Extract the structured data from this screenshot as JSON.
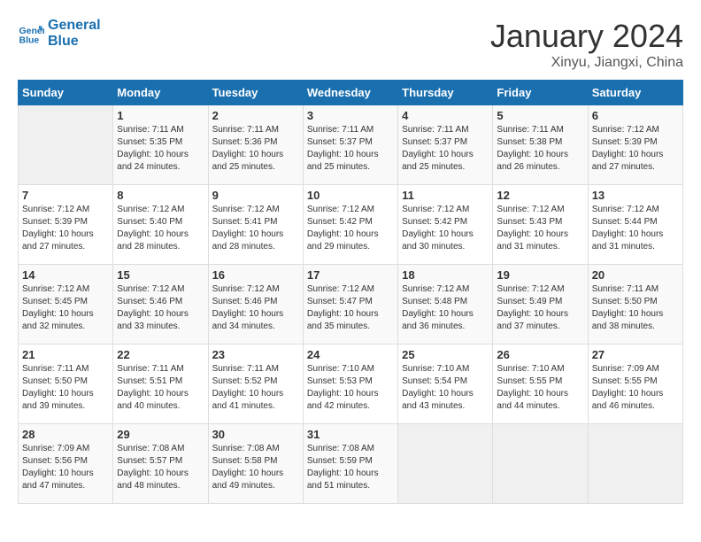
{
  "header": {
    "logo_line1": "General",
    "logo_line2": "Blue",
    "month": "January 2024",
    "location": "Xinyu, Jiangxi, China"
  },
  "weekdays": [
    "Sunday",
    "Monday",
    "Tuesday",
    "Wednesday",
    "Thursday",
    "Friday",
    "Saturday"
  ],
  "weeks": [
    [
      {
        "day": "",
        "info": ""
      },
      {
        "day": "1",
        "info": "Sunrise: 7:11 AM\nSunset: 5:35 PM\nDaylight: 10 hours\nand 24 minutes."
      },
      {
        "day": "2",
        "info": "Sunrise: 7:11 AM\nSunset: 5:36 PM\nDaylight: 10 hours\nand 25 minutes."
      },
      {
        "day": "3",
        "info": "Sunrise: 7:11 AM\nSunset: 5:37 PM\nDaylight: 10 hours\nand 25 minutes."
      },
      {
        "day": "4",
        "info": "Sunrise: 7:11 AM\nSunset: 5:37 PM\nDaylight: 10 hours\nand 25 minutes."
      },
      {
        "day": "5",
        "info": "Sunrise: 7:11 AM\nSunset: 5:38 PM\nDaylight: 10 hours\nand 26 minutes."
      },
      {
        "day": "6",
        "info": "Sunrise: 7:12 AM\nSunset: 5:39 PM\nDaylight: 10 hours\nand 27 minutes."
      }
    ],
    [
      {
        "day": "7",
        "info": "Sunrise: 7:12 AM\nSunset: 5:39 PM\nDaylight: 10 hours\nand 27 minutes."
      },
      {
        "day": "8",
        "info": "Sunrise: 7:12 AM\nSunset: 5:40 PM\nDaylight: 10 hours\nand 28 minutes."
      },
      {
        "day": "9",
        "info": "Sunrise: 7:12 AM\nSunset: 5:41 PM\nDaylight: 10 hours\nand 28 minutes."
      },
      {
        "day": "10",
        "info": "Sunrise: 7:12 AM\nSunset: 5:42 PM\nDaylight: 10 hours\nand 29 minutes."
      },
      {
        "day": "11",
        "info": "Sunrise: 7:12 AM\nSunset: 5:42 PM\nDaylight: 10 hours\nand 30 minutes."
      },
      {
        "day": "12",
        "info": "Sunrise: 7:12 AM\nSunset: 5:43 PM\nDaylight: 10 hours\nand 31 minutes."
      },
      {
        "day": "13",
        "info": "Sunrise: 7:12 AM\nSunset: 5:44 PM\nDaylight: 10 hours\nand 31 minutes."
      }
    ],
    [
      {
        "day": "14",
        "info": "Sunrise: 7:12 AM\nSunset: 5:45 PM\nDaylight: 10 hours\nand 32 minutes."
      },
      {
        "day": "15",
        "info": "Sunrise: 7:12 AM\nSunset: 5:46 PM\nDaylight: 10 hours\nand 33 minutes."
      },
      {
        "day": "16",
        "info": "Sunrise: 7:12 AM\nSunset: 5:46 PM\nDaylight: 10 hours\nand 34 minutes."
      },
      {
        "day": "17",
        "info": "Sunrise: 7:12 AM\nSunset: 5:47 PM\nDaylight: 10 hours\nand 35 minutes."
      },
      {
        "day": "18",
        "info": "Sunrise: 7:12 AM\nSunset: 5:48 PM\nDaylight: 10 hours\nand 36 minutes."
      },
      {
        "day": "19",
        "info": "Sunrise: 7:12 AM\nSunset: 5:49 PM\nDaylight: 10 hours\nand 37 minutes."
      },
      {
        "day": "20",
        "info": "Sunrise: 7:11 AM\nSunset: 5:50 PM\nDaylight: 10 hours\nand 38 minutes."
      }
    ],
    [
      {
        "day": "21",
        "info": "Sunrise: 7:11 AM\nSunset: 5:50 PM\nDaylight: 10 hours\nand 39 minutes."
      },
      {
        "day": "22",
        "info": "Sunrise: 7:11 AM\nSunset: 5:51 PM\nDaylight: 10 hours\nand 40 minutes."
      },
      {
        "day": "23",
        "info": "Sunrise: 7:11 AM\nSunset: 5:52 PM\nDaylight: 10 hours\nand 41 minutes."
      },
      {
        "day": "24",
        "info": "Sunrise: 7:10 AM\nSunset: 5:53 PM\nDaylight: 10 hours\nand 42 minutes."
      },
      {
        "day": "25",
        "info": "Sunrise: 7:10 AM\nSunset: 5:54 PM\nDaylight: 10 hours\nand 43 minutes."
      },
      {
        "day": "26",
        "info": "Sunrise: 7:10 AM\nSunset: 5:55 PM\nDaylight: 10 hours\nand 44 minutes."
      },
      {
        "day": "27",
        "info": "Sunrise: 7:09 AM\nSunset: 5:55 PM\nDaylight: 10 hours\nand 46 minutes."
      }
    ],
    [
      {
        "day": "28",
        "info": "Sunrise: 7:09 AM\nSunset: 5:56 PM\nDaylight: 10 hours\nand 47 minutes."
      },
      {
        "day": "29",
        "info": "Sunrise: 7:08 AM\nSunset: 5:57 PM\nDaylight: 10 hours\nand 48 minutes."
      },
      {
        "day": "30",
        "info": "Sunrise: 7:08 AM\nSunset: 5:58 PM\nDaylight: 10 hours\nand 49 minutes."
      },
      {
        "day": "31",
        "info": "Sunrise: 7:08 AM\nSunset: 5:59 PM\nDaylight: 10 hours\nand 51 minutes."
      },
      {
        "day": "",
        "info": ""
      },
      {
        "day": "",
        "info": ""
      },
      {
        "day": "",
        "info": ""
      }
    ]
  ]
}
